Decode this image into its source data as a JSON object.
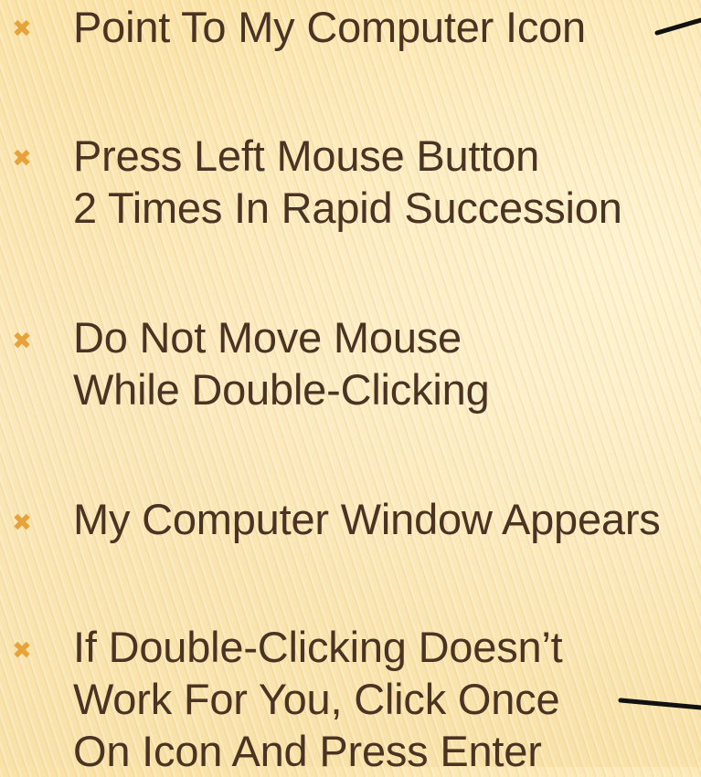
{
  "bullets": [
    {
      "marker": "✖",
      "lines": [
        "Point To My Computer Icon"
      ]
    },
    {
      "marker": "✖",
      "lines": [
        "Press Left Mouse Button",
        "2 Times In Rapid Succession"
      ]
    },
    {
      "marker": "✖",
      "lines": [
        "Do Not Move Mouse",
        "While Double-Clicking"
      ]
    },
    {
      "marker": "✖",
      "lines": [
        "My Computer Window Appears"
      ]
    },
    {
      "marker": "✖",
      "lines": [
        "If Double-Clicking Doesn’t",
        "Work For You, Click Once",
        "On Icon And Press Enter"
      ]
    }
  ],
  "colors": {
    "text": "#4a3322",
    "marker": "#e8a23a",
    "connector": "#111111"
  }
}
